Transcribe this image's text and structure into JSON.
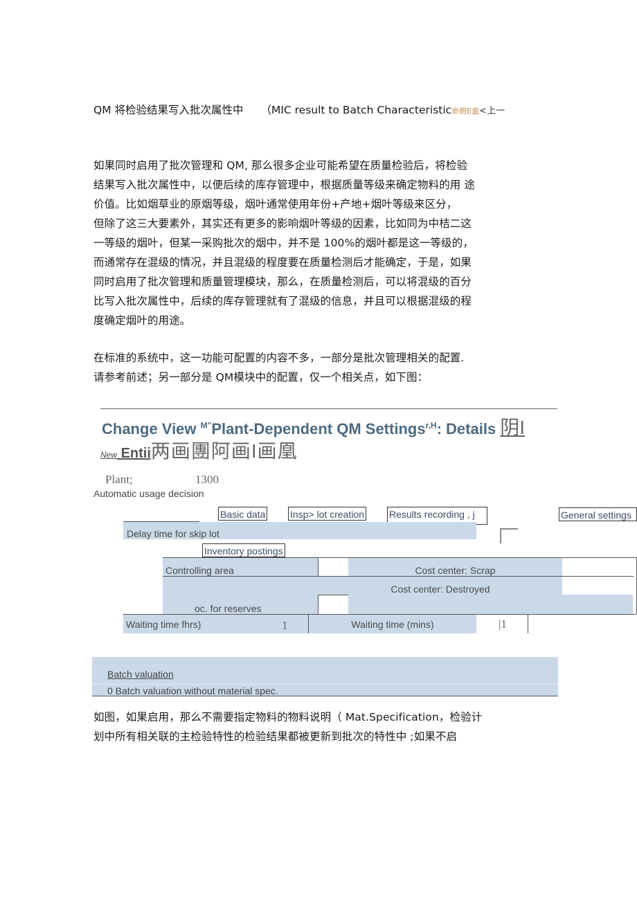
{
  "heading": {
    "main": "QM 将检验结果写入批次属性中",
    "english": "（MIC result to Batch Characteristic",
    "ornament": "命俯E盒",
    "tail": "<上一"
  },
  "paragraph1": [
    "如果同时启用了批次管理和  QM, 那么很多企业可能希望在质量检验后，将检验",
    "结果写入批次属性中，以便后续的库存管理中，根据质量等级来确定物料的用  途",
    "价值。比如烟草业的原烟等级，烟叶通常使用年份+产地+烟叶等级来区分，",
    "但除了这三大要素外，其实还有更多的影响烟叶等级的因素，比如同为中桔二这",
    "一等级的烟叶，但某一采购批次的烟中，并不是       100%的烟叶都是这一等级的，",
    "而通常存在混级的情况，并且混级的程度要在质量检测后才能确定，于是，如果",
    "同时启用了批次管理和质量管理模块，那么，在质量检测后，可以将混级的百分",
    "比写入批次属性中，后续的库存管理就有了混级的信息，并且可以根据混级的程",
    "度确定烟叶的用途。"
  ],
  "paragraph2": [
    "在标准的系统中，这一功能可配置的内容不多，一部分是批次管理相关的配置.",
    "请参考前述；另一部分是  QM模块中的配置，仅一个相关点，如下图："
  ],
  "sap": {
    "title_prefix": "Change View ",
    "title_sup1": "M\"",
    "title_main": "Plant-Dependent QM Settings",
    "title_sup2": "r,H",
    "title_suffix": ": Details ",
    "title_glyph": "阴I",
    "toolbar_new": "New",
    "toolbar_entries": " Entii",
    "toolbar_icons": "两画團阿画I画凰",
    "plant_label": "Plant;",
    "plant_value": "1300",
    "auto_usage_decision": "Automatic usage decision",
    "tabs": {
      "basic_data": "Basic data",
      "insp_lot_creation": "Insp> lot creation",
      "results_recording": "Results recording , j",
      "general_settings": "General settings"
    },
    "delay_time_skip_lot": "Delay time for skip lot",
    "inventory_postings": "Inventory postings",
    "controlling_area": "Controlling area",
    "cost_center_scrap": "Cost center: Scrap",
    "cost_center_destroyed": "Cost center: Destroyed",
    "acc_for_reserves": "oc. for reserves",
    "waiting_time_hrs_label": "Waiting time fhrs)",
    "waiting_time_hrs_value": "1",
    "waiting_time_mins_label": "Waiting time (mins)",
    "waiting_time_mins_value": "|1",
    "batch_valuation_label": "Batch valuation",
    "batch_valuation_value": "0 Batch valuation without material spec."
  },
  "paragraph3": [
    "如图，如果启用，那么不需要指定物料的物料说明（       Mat.Specification，检验计",
    "划中所有相关联的主检验特性的检验结果都被更新到批次的特性中       ;如果不启"
  ]
}
